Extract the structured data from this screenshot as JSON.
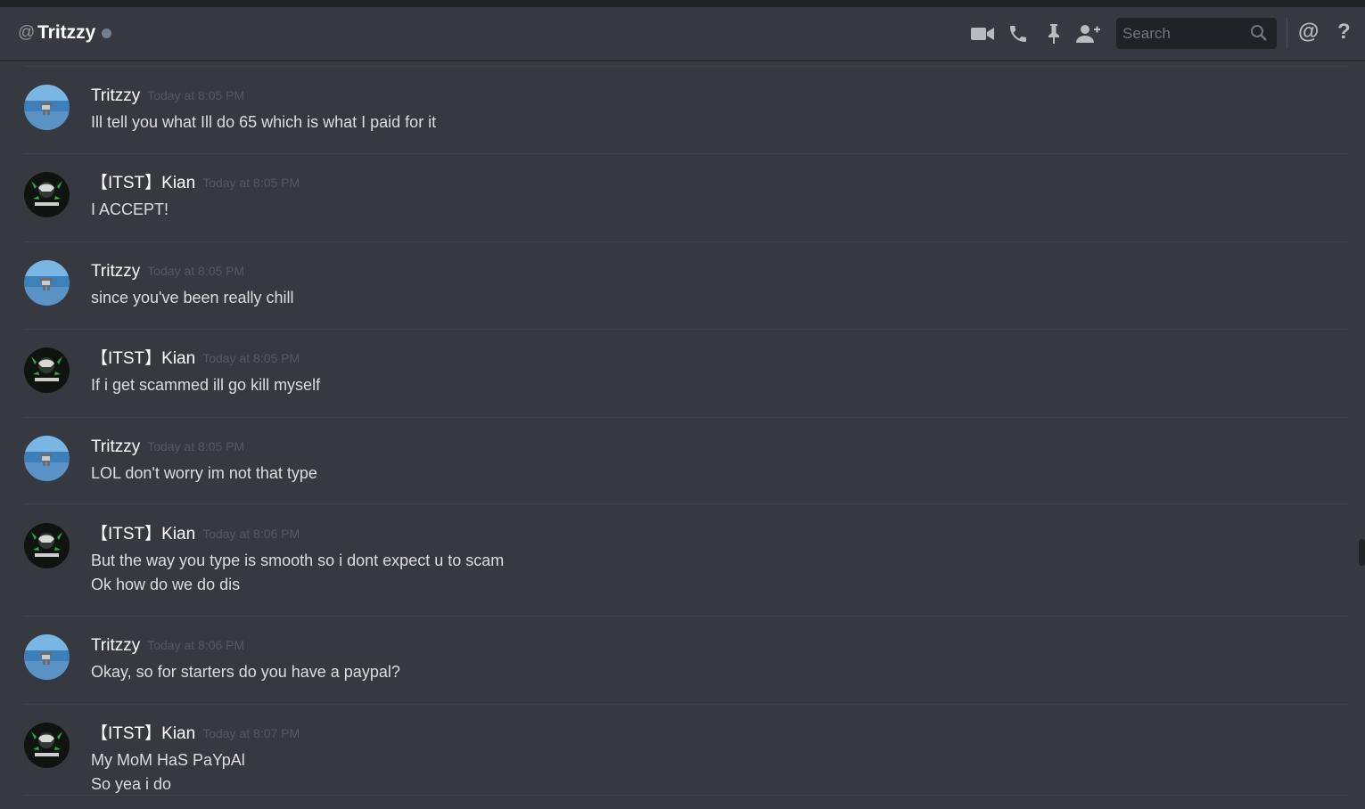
{
  "header": {
    "at_symbol": "@",
    "channel_name": "Tritzzy",
    "search_placeholder": "Search",
    "mention_symbol": "@",
    "help_symbol": "?"
  },
  "icons": [
    "video-icon",
    "phone-icon",
    "pin-icon",
    "add-friend-icon",
    "search-icon",
    "mention-icon",
    "help-icon"
  ],
  "colors": {
    "background": "#36393f",
    "header_bg": "#36393f",
    "search_bg": "#202225",
    "text": "#dcddde",
    "timestamp": "#555960",
    "status_offline": "#747f8d"
  },
  "messages": [
    {
      "author": "Tritzzy",
      "timestamp": "Today at 8:05 PM",
      "lines": [
        "Ill tell you what Ill do 65 which is what I paid for it"
      ]
    },
    {
      "author": "【ITST】Kian",
      "timestamp": "Today at 8:05 PM",
      "lines": [
        "I ACCEPT!"
      ]
    },
    {
      "author": "Tritzzy",
      "timestamp": "Today at 8:05 PM",
      "lines": [
        "since you've been really chill"
      ]
    },
    {
      "author": "【ITST】Kian",
      "timestamp": "Today at 8:05 PM",
      "lines": [
        "If i get scammed ill go kill myself"
      ]
    },
    {
      "author": "Tritzzy",
      "timestamp": "Today at 8:05 PM",
      "lines": [
        "LOL don't worry im not that type"
      ]
    },
    {
      "author": "【ITST】Kian",
      "timestamp": "Today at 8:06 PM",
      "lines": [
        "But the way you type is smooth so i dont expect u to scam",
        "Ok how do we do dis"
      ]
    },
    {
      "author": "Tritzzy",
      "timestamp": "Today at 8:06 PM",
      "lines": [
        "Okay, so for starters do you have a paypal?"
      ]
    },
    {
      "author": "【ITST】Kian",
      "timestamp": "Today at 8:07 PM",
      "lines": [
        "My MoM HaS PaYpAl",
        "So yea i do"
      ]
    }
  ]
}
